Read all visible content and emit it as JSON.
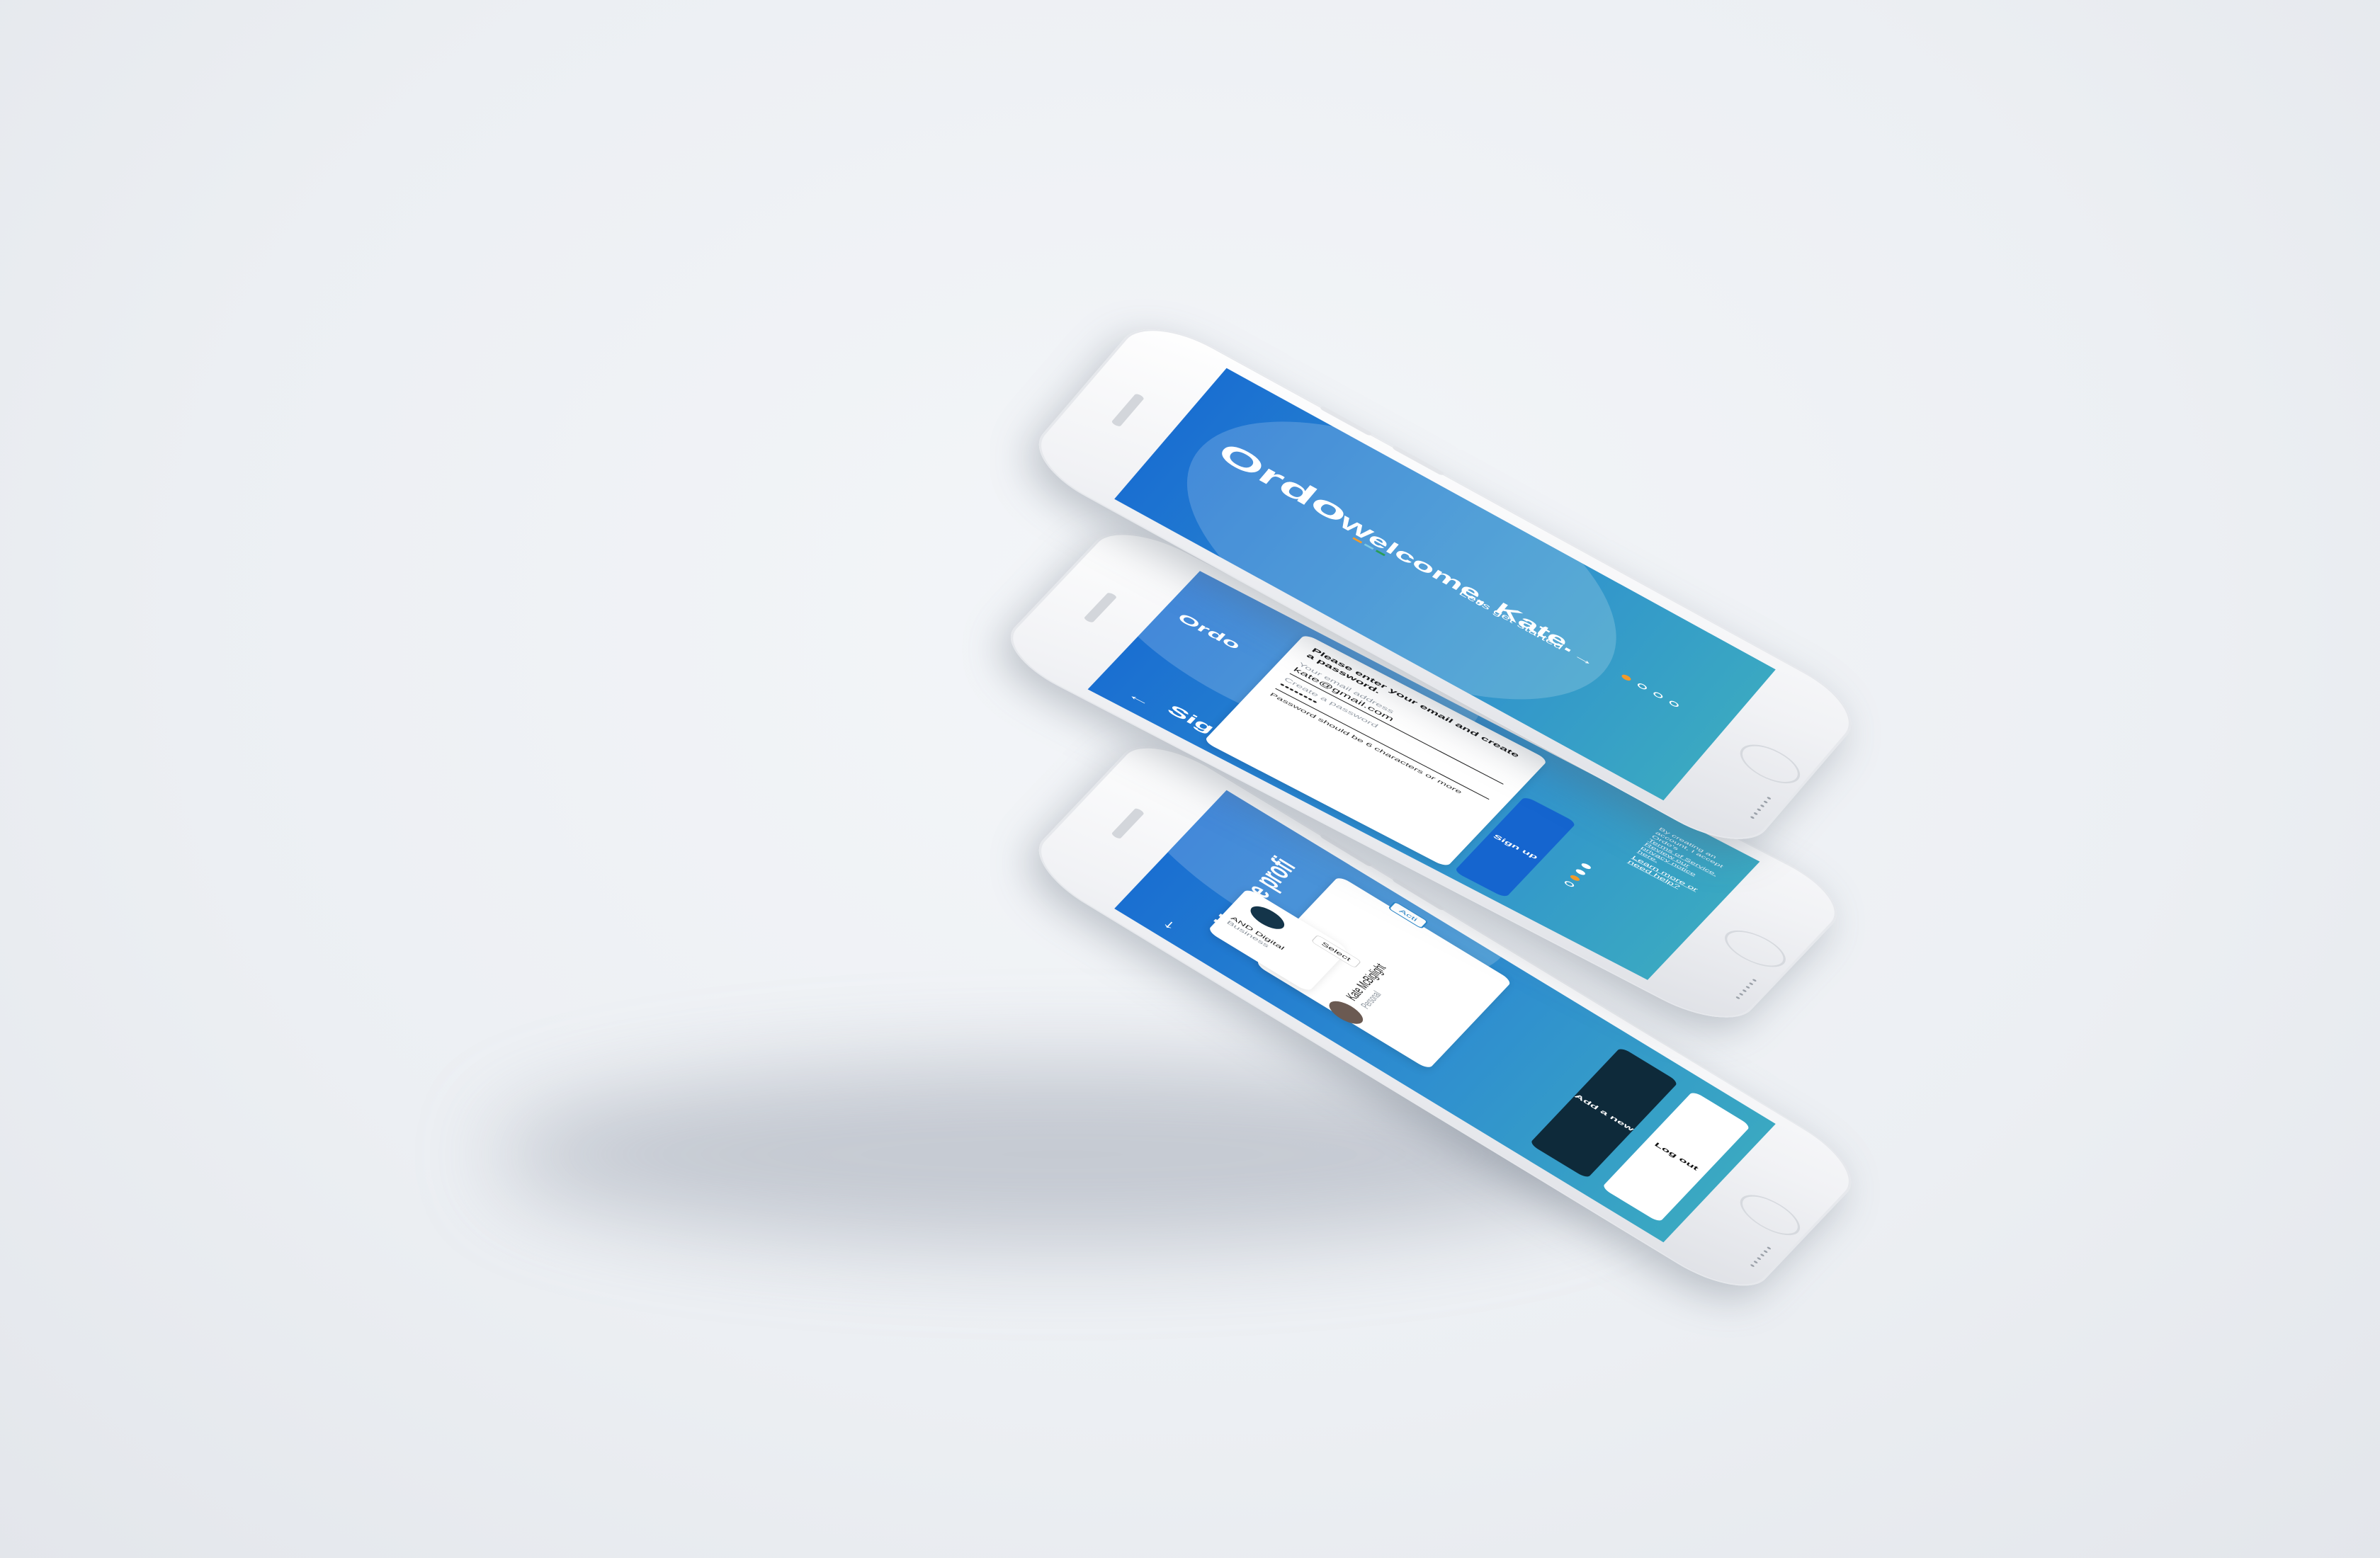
{
  "colors": {
    "brand_blue": "#1a6fd1",
    "teal": "#3aa8c2",
    "accent_orange": "#f39a2a",
    "dark_button": "#0e2a3a"
  },
  "welcome": {
    "logo": "Ordo",
    "title": "Welcome, Kate.",
    "cta": "Let's get started",
    "cta_icon": "arrow-right-icon",
    "active_dot": 1
  },
  "signup": {
    "logo": "Ordo",
    "back_icon": "back-arrow-icon",
    "title": "Sign up",
    "prompt": "Please enter your email and create a password.",
    "email_label": "Your email address",
    "email_value": "kate@gmail.com",
    "password_label": "Create a password",
    "password_value": "••••••••",
    "hint": "Password should be 6 characters or more",
    "button": "Sign up",
    "terms_line1": "By creating an account, I accept Ordo's",
    "terms_line2": "Terms of Service. Review our privacy notice here.",
    "help": "Learn more or need help?"
  },
  "profiles": {
    "back_icon": "back-arrow-icon",
    "title": "Manage profi",
    "items": [
      {
        "name": "Kate McBiglight",
        "type": "Personal",
        "action": "Acti"
      },
      {
        "name": "AND Digital",
        "type": "Business",
        "action": "Select"
      }
    ],
    "add_button": "Add a new profile",
    "logout_button": "Log out"
  }
}
